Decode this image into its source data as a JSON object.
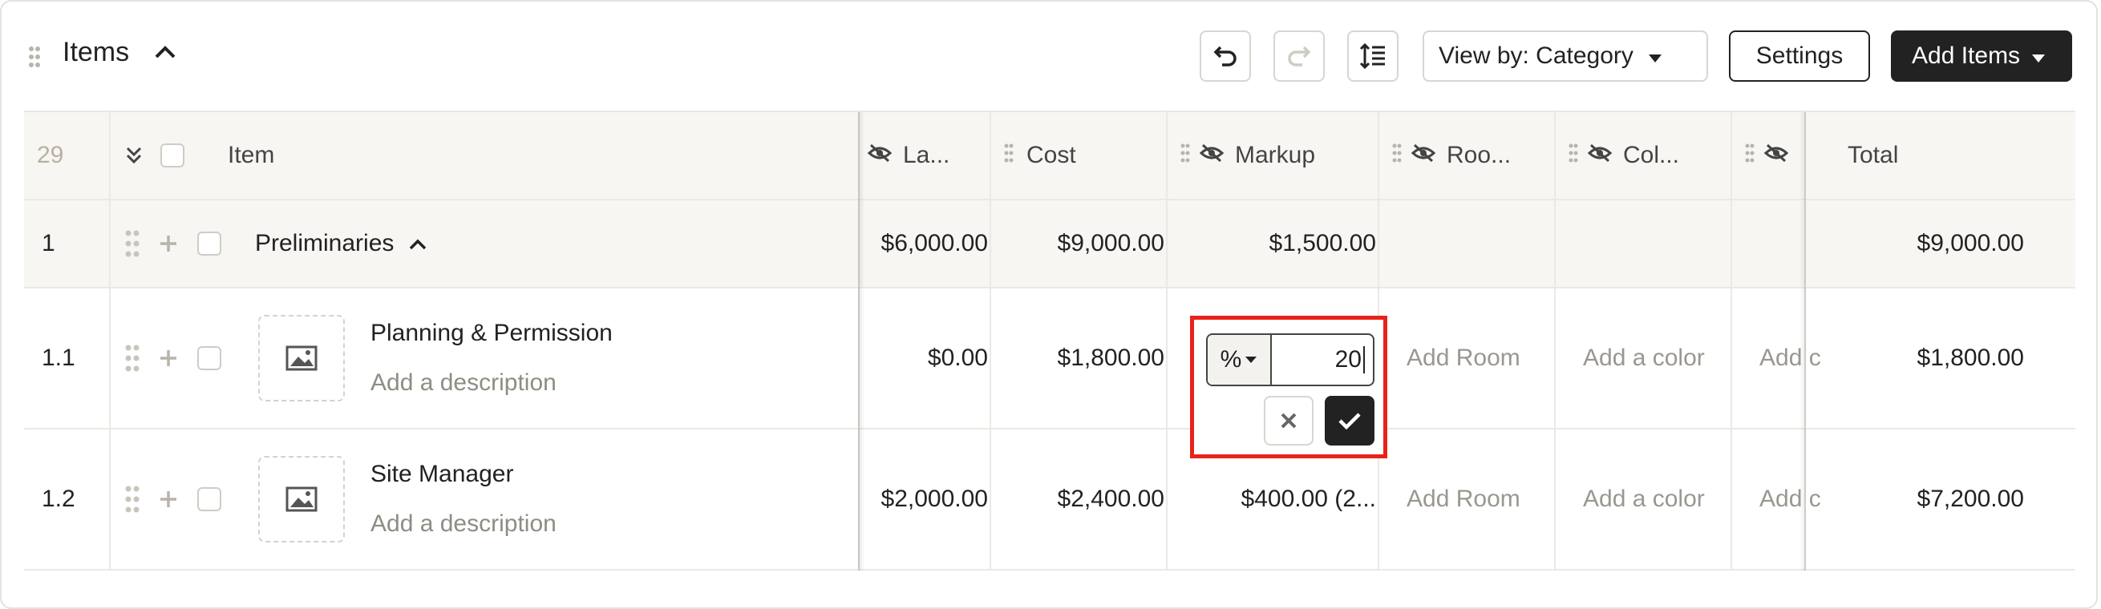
{
  "header": {
    "title": "Items",
    "view_by_label": "View by: Category",
    "settings_label": "Settings",
    "add_items_label": "Add Items"
  },
  "table": {
    "count": "29",
    "columns": {
      "item": "Item",
      "labor": "La...",
      "cost": "Cost",
      "markup": "Markup",
      "room": "Roo...",
      "color": "Col...",
      "total": "Total"
    },
    "group": {
      "number": "1",
      "name": "Preliminaries",
      "labor": "$6,000.00",
      "cost": "$9,000.00",
      "markup": "$1,500.00",
      "total": "$9,000.00"
    },
    "rows": [
      {
        "number": "1.1",
        "name": "Planning & Permission",
        "description": "Add a description",
        "labor": "$0.00",
        "cost": "$1,800.00",
        "room": "Add Room",
        "color": "Add a color",
        "extra": "Add c",
        "total": "$1,800.00"
      },
      {
        "number": "1.2",
        "name": "Site Manager",
        "description": "Add a description",
        "labor": "$2,000.00",
        "cost": "$2,400.00",
        "markup": "$400.00 (2...",
        "room": "Add Room",
        "color": "Add a color",
        "extra": "Add c",
        "total": "$7,200.00"
      }
    ]
  },
  "markup_editor": {
    "unit": "%",
    "value": "20"
  },
  "icons": {
    "drag": "drag-handle-icon",
    "undo": "undo-icon",
    "redo": "redo-icon",
    "line_height": "line-spacing-icon",
    "hidden": "eye-off-icon",
    "image": "image-placeholder-icon",
    "check": "check-icon",
    "close": "close-icon"
  },
  "colors": {
    "accent": "#222222",
    "highlight": "#e8231b",
    "muted_text": "#9a978f"
  }
}
